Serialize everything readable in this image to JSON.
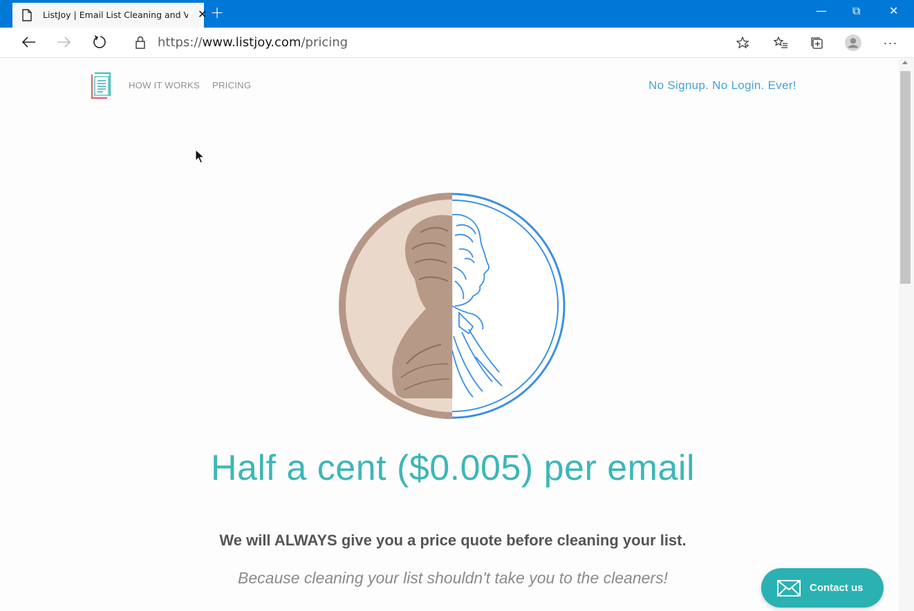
{
  "browser": {
    "tab_title": "ListJoy | Email List Cleaning and V",
    "tab_close": "✕",
    "new_tab": "+",
    "url_scheme": "https://",
    "url_host": "www.listjoy.com",
    "url_path": "/pricing",
    "window_controls": {
      "minimize": "—",
      "restore": "⧉",
      "close": "✕"
    },
    "toolbar_icons": [
      "back-icon",
      "forward-icon",
      "refresh-icon",
      "lock-icon",
      "favorite-star-icon",
      "favorites-list-icon",
      "collections-icon",
      "profile-avatar-icon",
      "more-menu-icon"
    ],
    "more_label": "···"
  },
  "site": {
    "nav": {
      "how_it_works": "HOW IT WORKS",
      "pricing": "PRICING"
    },
    "tagline": "No Signup. No Login. Ever!"
  },
  "main": {
    "headline": "Half a cent ($0.005) per email",
    "subhead": "We will ALWAYS give you a price quote before cleaning your list.",
    "subtext": "Because cleaning your list shouldn't take you to the cleaners!"
  },
  "contact": {
    "label": "Contact us",
    "icon": "envelope-icon"
  },
  "colors": {
    "titlebar": "#0078d7",
    "accent_teal": "#3db7b5",
    "tagline_blue": "#43a4d8",
    "coin_copper": "#b59787",
    "coin_blue": "#3a8ee6",
    "contact_bg": "#2ab1b1"
  }
}
